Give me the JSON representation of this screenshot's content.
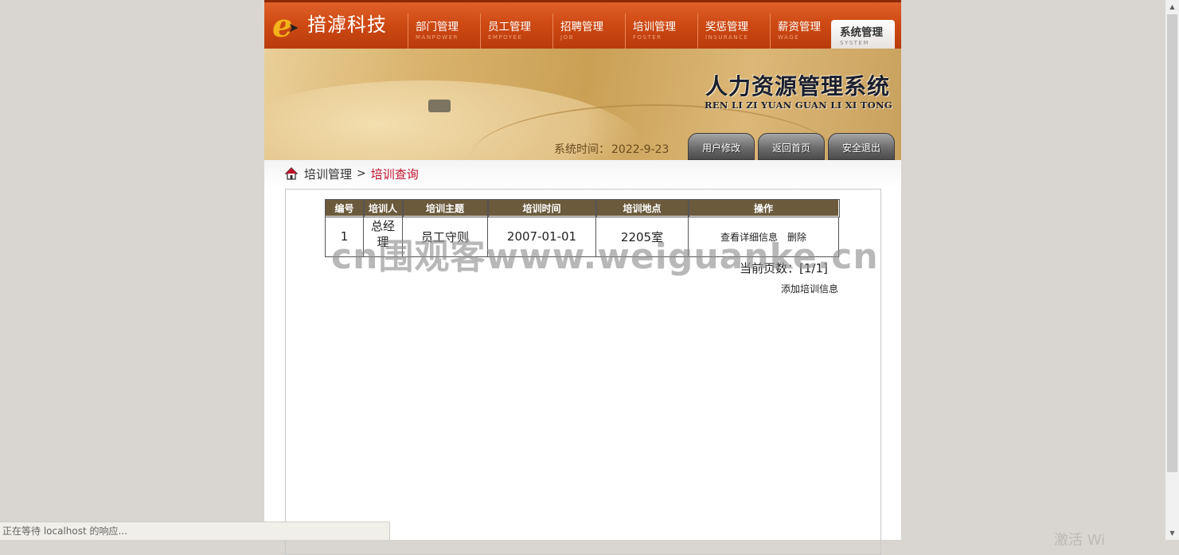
{
  "header": {
    "logo_text": "揞滹科技",
    "nav": [
      {
        "cn": "部门管理",
        "en": "MANPOWER"
      },
      {
        "cn": "员工管理",
        "en": "EMPOYEE"
      },
      {
        "cn": "招聘管理",
        "en": "JOB"
      },
      {
        "cn": "培训管理",
        "en": "FOSTER"
      },
      {
        "cn": "奖惩管理",
        "en": "INSURANCE"
      },
      {
        "cn": "薪资管理",
        "en": "WAGE"
      },
      {
        "cn": "系统管理",
        "en": "SYSTEM"
      }
    ],
    "active_nav": "系统管理"
  },
  "banner": {
    "title": "人力资源管理系统",
    "pinyin": "REN LI ZI YUAN GUAN LI XI TONG",
    "time_label": "系统时间：",
    "time_value": "2022-9-23",
    "buttons": [
      "用户修改",
      "返回首页",
      "安全退出"
    ]
  },
  "breadcrumb": {
    "parent": "培训管理",
    "separator": ">",
    "current": "培训查询"
  },
  "table": {
    "headers": [
      "编号",
      "培训人",
      "培训主题",
      "培训时间",
      "培训地点",
      "操作"
    ],
    "rows": [
      {
        "id": "1",
        "person": "总经理",
        "topic": "员工守则",
        "date": "2007-01-01",
        "place": "2205室",
        "op_view": "查看详细信息",
        "op_delete": "删除"
      }
    ]
  },
  "pagination": {
    "text": "当前页数：[1/1]"
  },
  "add_link": "添加培训信息",
  "watermark": "cn围观客www.weiguanke.cn",
  "status_bar": "正在等待 localhost 的响应...",
  "os_overlay": "激活 Wi"
}
